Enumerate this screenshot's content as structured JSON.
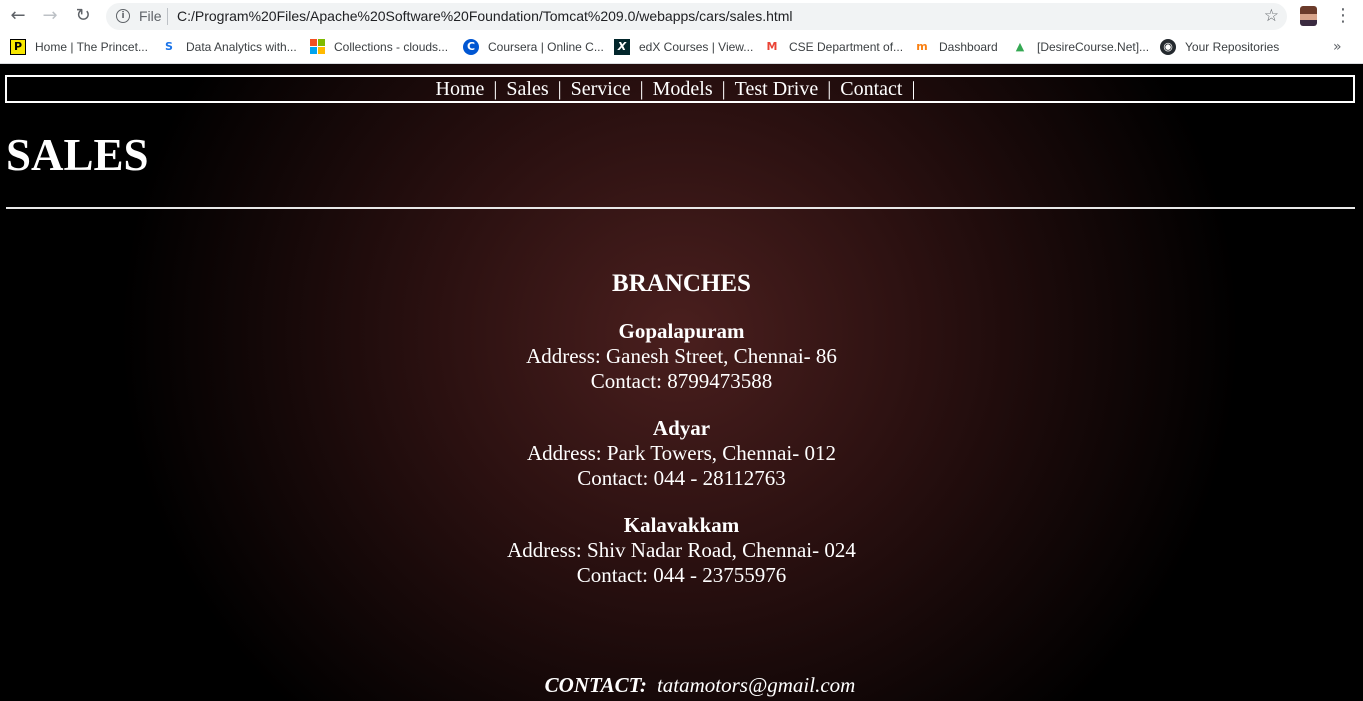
{
  "browser": {
    "scheme_label": "File",
    "url": "C:/Program%20Files/Apache%20Software%20Foundation/Tomcat%209.0/webapps/cars/sales.html",
    "bookmarks": [
      {
        "label": "Home | The Princet...",
        "icon": "princeton-review-icon",
        "color": "#000000"
      },
      {
        "label": "Data Analytics with...",
        "icon": "s-logo-icon",
        "color": "#1a73e8"
      },
      {
        "label": "Collections - clouds...",
        "icon": "microsoft-logo-icon",
        "color": "#f25022"
      },
      {
        "label": "Coursera | Online C...",
        "icon": "coursera-icon",
        "color": "#0056d2"
      },
      {
        "label": "edX Courses | View...",
        "icon": "edx-icon",
        "color": "#02262b"
      },
      {
        "label": "CSE Department of...",
        "icon": "gmail-icon",
        "color": "#ea4335"
      },
      {
        "label": "Dashboard",
        "icon": "moodle-icon",
        "color": "#f98012"
      },
      {
        "label": "[DesireCourse.Net]...",
        "icon": "google-drive-icon",
        "color": "#34a853"
      },
      {
        "label": "Your Repositories",
        "icon": "github-icon",
        "color": "#24292e"
      }
    ],
    "more_label": "»"
  },
  "nav": {
    "items": [
      "Home",
      "Sales",
      "Service",
      "Models",
      "Test Drive",
      "Contact"
    ],
    "separator": "|"
  },
  "page": {
    "title": "SALES",
    "branches_title": "BRANCHES",
    "branches": [
      {
        "name": "Gopalapuram",
        "address": "Address: Ganesh Street, Chennai- 86",
        "contact": "Contact: 8799473588"
      },
      {
        "name": "Adyar",
        "address": "Address: Park Towers, Chennai- 012",
        "contact": "Contact: 044 - 28112763"
      },
      {
        "name": "Kalavakkam",
        "address": "Address: Shiv Nadar Road, Chennai- 024",
        "contact": "Contact: 044 - 23755976"
      }
    ],
    "contact_label": "CONTACT:",
    "contact_email": "tatamotors@gmail.com"
  }
}
